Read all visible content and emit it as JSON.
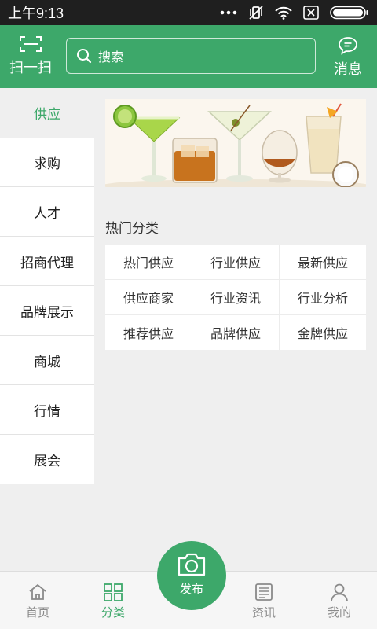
{
  "status_bar": {
    "time": "上午9:13"
  },
  "header": {
    "scan_label": "扫一扫",
    "search_placeholder": "搜索",
    "message_label": "消息"
  },
  "sidebar": {
    "items": [
      {
        "label": "供应",
        "active": true
      },
      {
        "label": "求购"
      },
      {
        "label": "人才"
      },
      {
        "label": "招商代理"
      },
      {
        "label": "品牌展示"
      },
      {
        "label": "商城"
      },
      {
        "label": "行情"
      },
      {
        "label": "展会"
      }
    ]
  },
  "category": {
    "title": "热门分类",
    "items": [
      "热门供应",
      "行业供应",
      "最新供应",
      "供应商家",
      "行业资讯",
      "行业分析",
      "推荐供应",
      "品牌供应",
      "金牌供应"
    ]
  },
  "bottom_nav": {
    "home": "首页",
    "category": "分类",
    "publish": "发布",
    "news": "资讯",
    "mine": "我的"
  },
  "colors": {
    "brand": "#3da86a",
    "status_bar": "#1f1f1f",
    "background": "#efefef"
  }
}
